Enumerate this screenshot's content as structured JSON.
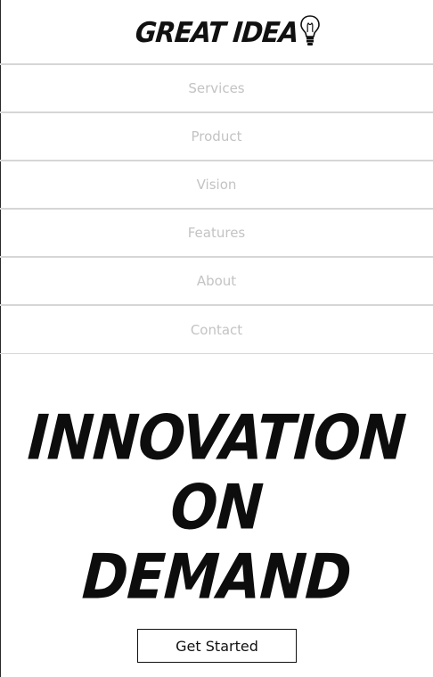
{
  "header": {
    "logo_text": "GREAT IDEA",
    "logo_icon": "lightbulb-icon"
  },
  "nav": {
    "items": [
      {
        "label": "Services"
      },
      {
        "label": "Product"
      },
      {
        "label": "Vision"
      },
      {
        "label": "Features"
      },
      {
        "label": "About"
      },
      {
        "label": "Contact"
      }
    ]
  },
  "hero": {
    "lines": [
      "INNOVATION",
      "ON",
      "DEMAND"
    ],
    "cta_label": "Get Started"
  },
  "colors": {
    "nav_text": "#c3c3c3",
    "divider": "#d6d6d6",
    "ink": "#111111"
  }
}
